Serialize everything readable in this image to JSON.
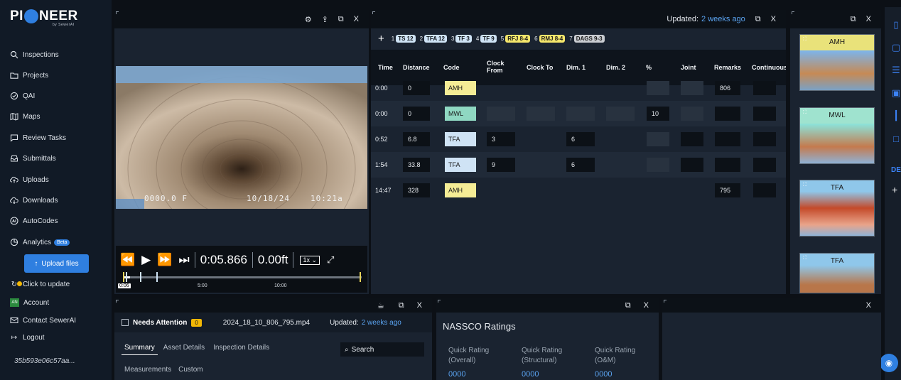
{
  "sidebar": {
    "logo_text": "PI NEER",
    "logo_by": "by SewerAI",
    "items": [
      {
        "label": "Inspections",
        "icon": "search-icon"
      },
      {
        "label": "Projects",
        "icon": "folder-icon"
      },
      {
        "label": "QAI",
        "icon": "check-circle-icon"
      },
      {
        "label": "Maps",
        "icon": "map-icon"
      },
      {
        "label": "Review Tasks",
        "icon": "chat-icon"
      },
      {
        "label": "Submittals",
        "icon": "inbox-icon"
      },
      {
        "label": "Uploads",
        "icon": "cloud-upload-icon"
      },
      {
        "label": "Downloads",
        "icon": "cloud-download-icon"
      },
      {
        "label": "AutoCodes",
        "icon": "ai-icon"
      },
      {
        "label": "Analytics",
        "icon": "pie-chart-icon",
        "badge": "Beta"
      }
    ],
    "upload_button": "Upload files",
    "click_to_update": "Click to update",
    "account": "Account",
    "account_initials": "AN",
    "contact": "Contact SewerAI",
    "logout": "Logout",
    "hash": "35b593e06c57aa..."
  },
  "video_panel": {
    "close": "X",
    "osd_distance": "0000.0 F",
    "osd_date": "10/18/24",
    "osd_time": "10:21a",
    "time": "0:05.866",
    "feet": "0.00ft",
    "speed": "1x",
    "timeline_labels": {
      "current": "0:06",
      "mid": "5:00",
      "end": "10:00"
    },
    "progress_fraction": 0.03
  },
  "table_panel": {
    "updated_label": "Updated:",
    "updated_value": "2 weeks ago",
    "close": "X",
    "add": "+",
    "tags": [
      {
        "num": "1",
        "label": "TS 12",
        "bg": "#cfe3f5",
        "fg": "#0c1117"
      },
      {
        "num": "2",
        "label": "TFA 12",
        "bg": "#cfe3f5",
        "fg": "#0c1117"
      },
      {
        "num": "3",
        "label": "TF 3",
        "bg": "#cfe3f5",
        "fg": "#0c1117"
      },
      {
        "num": "4",
        "label": "TF 9",
        "bg": "#cfe3f5",
        "fg": "#0c1117"
      },
      {
        "num": "5",
        "label": "RFJ 8-4",
        "bg": "#f5e66b",
        "fg": "#1a1a1a"
      },
      {
        "num": "6",
        "label": "RMJ 8-4",
        "bg": "#f5e66b",
        "fg": "#1a1a1a"
      },
      {
        "num": "7",
        "label": "DAGS 9-3",
        "bg": "#c9ccd1",
        "fg": "#1a1a1a"
      }
    ],
    "columns": [
      "Time",
      "Distance",
      "Code",
      "Clock From",
      "Clock To",
      "Dim. 1",
      "Dim. 2",
      "%",
      "Joint",
      "Remarks",
      "Continuous"
    ],
    "rows": [
      {
        "time": "0:00",
        "distance": "0",
        "code": "AMH",
        "code_color": "#f5ec95",
        "clock_from": "",
        "dim1": "",
        "pct": "",
        "remarks": "806"
      },
      {
        "time": "0:00",
        "distance": "0",
        "code": "MWL",
        "code_color": "#8fd8c2",
        "clock_from": "",
        "dim1": "",
        "pct": "10",
        "remarks": ""
      },
      {
        "time": "0:52",
        "distance": "6.8",
        "code": "TFA",
        "code_color": "#cfe3f5",
        "clock_from": "3",
        "dim1": "6",
        "pct": "",
        "remarks": ""
      },
      {
        "time": "1:54",
        "distance": "33.8",
        "code": "TFA",
        "code_color": "#cfe3f5",
        "clock_from": "9",
        "dim1": "6",
        "pct": "",
        "remarks": ""
      },
      {
        "time": "14:47",
        "distance": "328",
        "code": "AMH",
        "code_color": "#f5ec95",
        "clock_from": "",
        "dim1": "",
        "pct": "",
        "remarks": "795"
      }
    ]
  },
  "thumbs_panel": {
    "close": "X",
    "items": [
      {
        "label": "AMH",
        "bar": "#e9e27a"
      },
      {
        "label": "MWL",
        "bar": "#9fe3cf"
      },
      {
        "label": "TFA",
        "bar": "#b9d9f2"
      },
      {
        "label": "TFA",
        "bar": "#b9d9f2"
      }
    ]
  },
  "details_panel": {
    "close": "X",
    "needs_attention": "Needs Attention",
    "needs_count": "0",
    "filename": "2024_18_10_806_795.mp4",
    "updated_label": "Updated:",
    "updated_value": "2 weeks ago",
    "tabs": [
      "Summary",
      "Asset Details",
      "Inspection Details",
      "Measurements",
      "Custom"
    ],
    "search": "Search"
  },
  "nassco_panel": {
    "close": "X",
    "title": "NASSCO Ratings",
    "ratings": [
      {
        "label1": "Quick Rating",
        "label2": "(Overall)",
        "value": "0000"
      },
      {
        "label1": "Quick Rating",
        "label2": "(Structural)",
        "value": "0000"
      },
      {
        "label1": "Quick Rating",
        "label2": "(O&M)",
        "value": "0000"
      }
    ]
  },
  "empty_panel": {
    "close": "X"
  },
  "rail": {
    "label": "DE",
    "add": "+"
  }
}
